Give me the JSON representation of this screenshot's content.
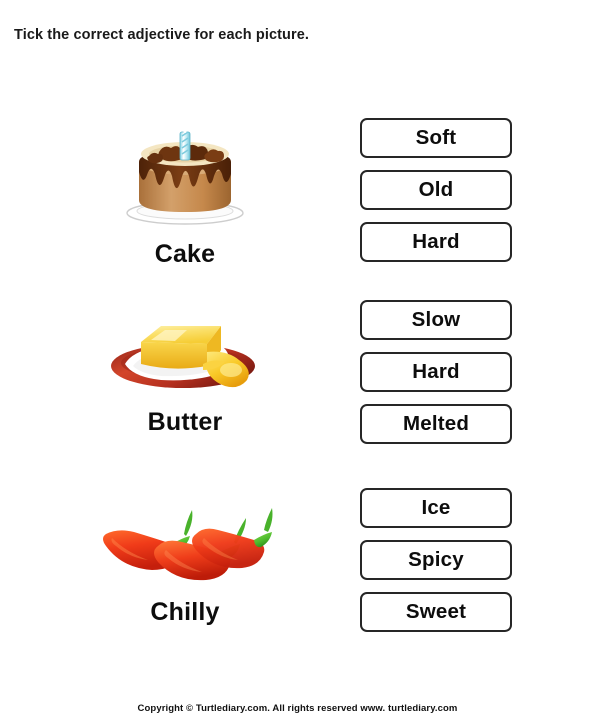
{
  "worksheet": {
    "title": "Tick the correct adjective for each picture.",
    "footer": "Copyright © Turtlediary.com. All rights reserved   www. turtlediary.com"
  },
  "questions": [
    {
      "label": "Cake",
      "image_name": "cake-illustration",
      "options": [
        "Soft",
        "Old",
        "Hard"
      ]
    },
    {
      "label": "Butter",
      "image_name": "butter-illustration",
      "options": [
        "Slow",
        "Hard",
        "Melted"
      ]
    },
    {
      "label": "Chilly",
      "image_name": "chilly-peppers-illustration",
      "options": [
        "Ice",
        "Spicy",
        "Sweet"
      ]
    }
  ],
  "colors": {
    "box_border": "#262626",
    "text": "#0d0d0d",
    "background": "#ffffff",
    "cake_body": "#c58a4e",
    "cake_chocolate": "#6b3410",
    "cake_cream": "#f2e3bd",
    "candle": "#a9e2ee",
    "butter_yellow": "#f7cf3a",
    "butter_dish": "#c0392b",
    "chilly_red": "#f03b19",
    "chilly_stem": "#58c13a"
  }
}
